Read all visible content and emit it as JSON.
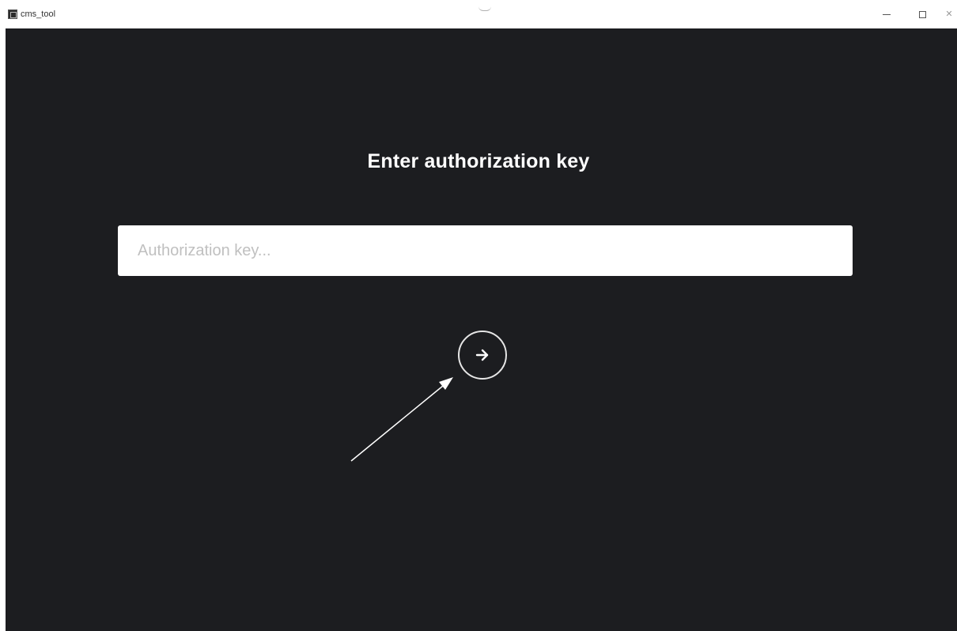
{
  "window": {
    "title": "cms_tool",
    "controls": [
      "minimize",
      "maximize",
      "close"
    ]
  },
  "main": {
    "heading": "Enter authorization key",
    "input": {
      "value": "",
      "placeholder": "Authorization key..."
    },
    "submit_icon": "arrow-right-icon"
  },
  "colors": {
    "background": "#1c1d20",
    "text": "#ffffff",
    "input_background": "#ffffff",
    "placeholder": "#c0c0c0"
  }
}
